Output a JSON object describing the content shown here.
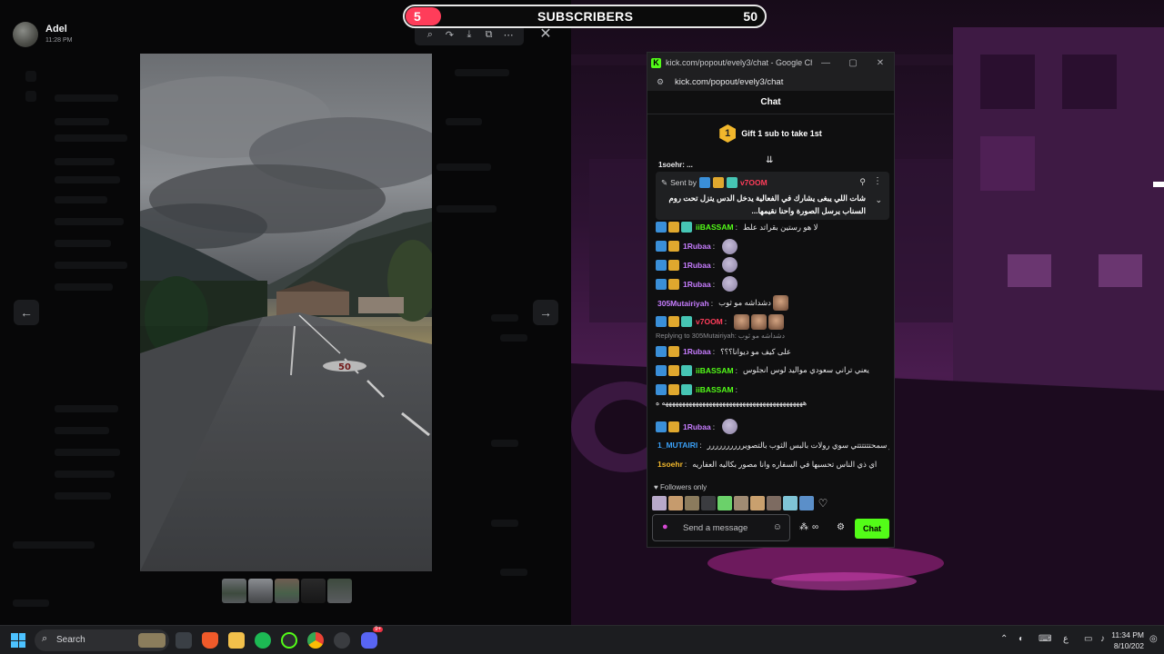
{
  "viewer": {
    "user_name": "Adel",
    "time": "11:28 PM",
    "toolbar_icons": [
      "zoom-icon",
      "forward-icon",
      "download-icon",
      "open-external-icon",
      "more-icon"
    ],
    "close_symbol": "✕",
    "prev_symbol": "←",
    "next_symbol": "→"
  },
  "subscribers": {
    "count": "5",
    "label": "SUBSCRIBERS",
    "goal": "50",
    "progress_fraction": 0.1,
    "bar_color": "#ff3d5a"
  },
  "chrome": {
    "title": "kick.com/popout/evely3/chat - Google Chro...",
    "url": "kick.com/popout/evely3/chat",
    "minimize": "—",
    "maximize": "▢",
    "close": "✕"
  },
  "chat": {
    "header": "Chat",
    "gift_badge_number": "1",
    "gift_text": "Gift 1 sub to take 1st",
    "pinned": {
      "sent_by_label": "Sent by",
      "sender": "v7OOM",
      "message": "شات اللي يبغى يشارك في الفعالية يدخل الدس يتزل تحت روم السناب يرسل الصورة واحنا نقيمها..."
    },
    "top_partial": "1soehr: ...",
    "messages": [
      {
        "user": "iiBASSAM",
        "color": "#53fc18",
        "badges": [
          "blue",
          "gold",
          "teal"
        ],
        "text": "لا هو رستين بقراتد علط",
        "emotes": 0,
        "faces": 0
      },
      {
        "user": "1Rubaa",
        "color": "#c77dff",
        "badges": [
          "blue",
          "gold"
        ],
        "text": "",
        "emotes": 1,
        "faces": 0
      },
      {
        "user": "1Rubaa",
        "color": "#c77dff",
        "badges": [
          "blue",
          "gold"
        ],
        "text": "",
        "emotes": 1,
        "faces": 0
      },
      {
        "user": "1Rubaa",
        "color": "#c77dff",
        "badges": [
          "blue",
          "gold"
        ],
        "text": "",
        "emotes": 1,
        "faces": 0
      },
      {
        "user": "305Mutairiyah",
        "color": "#c77dff",
        "badges": [],
        "text": "دشداشه مو ثوب",
        "emotes": 0,
        "faces": 1
      },
      {
        "user": "v7OOM",
        "color": "#ff3d5a",
        "badges": [
          "blue",
          "gold",
          "teal"
        ],
        "text": "",
        "emotes": 0,
        "faces": 3
      }
    ],
    "reply_line": "Replying to 305Mutairiyah: دشداشه مو ثوب",
    "messages2": [
      {
        "user": "1Rubaa",
        "color": "#c77dff",
        "badges": [
          "blue",
          "gold"
        ],
        "text": "على كيف مو ديوانا؟؟؟",
        "emotes": 0,
        "faces": 0
      },
      {
        "user": "iiBASSAM",
        "color": "#53fc18",
        "badges": [
          "blue",
          "gold",
          "teal"
        ],
        "text": "يعني تراني سعودي مواليد لوس انجلوس",
        "emotes": 0,
        "faces": 0
      },
      {
        "user": "iiBASSAM",
        "color": "#53fc18",
        "badges": [
          "blue",
          "gold",
          "teal"
        ],
        "text": "",
        "emotes": 0,
        "faces": 0
      }
    ],
    "long_line": "ههههههههههههههههههههههههههههههههههههههههههه ه",
    "messages3": [
      {
        "user": "1Rubaa",
        "color": "#c77dff",
        "badges": [
          "blue",
          "gold"
        ],
        "text": "",
        "emotes": 1,
        "faces": 0
      },
      {
        "user": "1_MUTAIRI",
        "color": "#3a9ff5",
        "badges": [],
        "text": "لو سمحتتتتتتي سوي رولات بالبس الثوب بالتصويرررررررررر",
        "emotes": 0,
        "faces": 0
      },
      {
        "user": "1soehr",
        "color": "#f1b72c",
        "badges": [],
        "text": "اي ذي الناس تحسبها في السفاره وانا مصور بكاليه العفاريه",
        "emotes": 0,
        "faces": 0
      }
    ],
    "followers_only": "Followers only",
    "input_placeholder": "Send a message",
    "send_label": "Chat"
  },
  "taskbar": {
    "search_label": "Search",
    "time": "11:34 PM",
    "date": "8/10/202",
    "lang": "ع",
    "notification_count": "9+"
  }
}
